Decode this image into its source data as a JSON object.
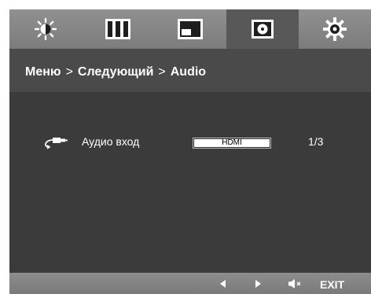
{
  "tabs": [
    {
      "icon": "brightness-icon",
      "active": false
    },
    {
      "icon": "picture-icon",
      "active": false
    },
    {
      "icon": "screen-icon",
      "active": false
    },
    {
      "icon": "disc-icon",
      "active": true
    },
    {
      "icon": "gear-icon",
      "active": false
    }
  ],
  "breadcrumb": {
    "part1": "Меню",
    "sep1": ">",
    "part2": "Следующий",
    "sep2": ">",
    "part3": "Audio"
  },
  "setting": {
    "icon": "audio-cable-icon",
    "label": "Аудио вход",
    "value": "HDMI",
    "page": "1/3"
  },
  "bottom_bar": {
    "left_icon": "left-arrow-icon",
    "right_icon": "right-arrow-icon",
    "volume_icon": "volume-icon",
    "exit_label": "EXIT"
  },
  "colors": {
    "osd_background": "#3b3b3b",
    "tab_bar": "#888888",
    "active_tab": "#585858",
    "text": "#ffffff"
  }
}
